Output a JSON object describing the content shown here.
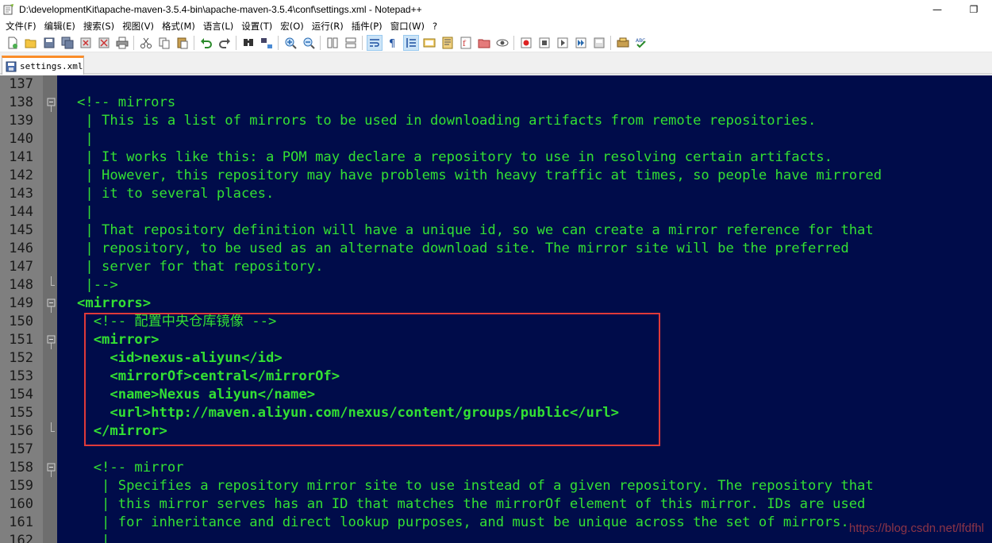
{
  "window": {
    "title": "D:\\developmentKit\\apache-maven-3.5.4-bin\\apache-maven-3.5.4\\conf\\settings.xml - Notepad++",
    "minimize": "—",
    "maximize": "❐"
  },
  "menu": {
    "items": [
      {
        "label": "文件(F)"
      },
      {
        "label": "编辑(E)"
      },
      {
        "label": "搜索(S)"
      },
      {
        "label": "视图(V)"
      },
      {
        "label": "格式(M)"
      },
      {
        "label": "语言(L)"
      },
      {
        "label": "设置(T)"
      },
      {
        "label": "宏(O)"
      },
      {
        "label": "运行(R)"
      },
      {
        "label": "插件(P)"
      },
      {
        "label": "窗口(W)"
      },
      {
        "label": "?"
      }
    ]
  },
  "tab": {
    "label": "settings.xml"
  },
  "colors": {
    "editor_bg": "#000c4a",
    "code_green": "#33e033",
    "gutter": "#7f7f7f",
    "highlight": "#e03a3a",
    "tab_accent": "#fa8d29"
  },
  "lines": [
    {
      "num": "137",
      "text": "",
      "fold": "line",
      "style": "comment"
    },
    {
      "num": "138",
      "text": "<!-- mirrors",
      "fold": "open",
      "style": "comment"
    },
    {
      "num": "139",
      "text": " | This is a list of mirrors to be used in downloading artifacts from remote repositories.",
      "fold": "line",
      "style": "comment"
    },
    {
      "num": "140",
      "text": " |",
      "fold": "line",
      "style": "comment"
    },
    {
      "num": "141",
      "text": " | It works like this: a POM may declare a repository to use in resolving certain artifacts.",
      "fold": "line",
      "style": "comment"
    },
    {
      "num": "142",
      "text": " | However, this repository may have problems with heavy traffic at times, so people have mirrored",
      "fold": "line",
      "style": "comment"
    },
    {
      "num": "143",
      "text": " | it to several places.",
      "fold": "line",
      "style": "comment"
    },
    {
      "num": "144",
      "text": " |",
      "fold": "line",
      "style": "comment"
    },
    {
      "num": "145",
      "text": " | That repository definition will have a unique id, so we can create a mirror reference for that",
      "fold": "line",
      "style": "comment"
    },
    {
      "num": "146",
      "text": " | repository, to be used as an alternate download site. The mirror site will be the preferred",
      "fold": "line",
      "style": "comment"
    },
    {
      "num": "147",
      "text": " | server for that repository.",
      "fold": "line",
      "style": "comment"
    },
    {
      "num": "148",
      "text": " |-->",
      "fold": "end",
      "style": "comment"
    },
    {
      "num": "149",
      "text": "<mirrors>",
      "fold": "open",
      "style": "bold"
    },
    {
      "num": "150",
      "text": "  <!-- 配置中央仓库镜像 -->",
      "fold": "line",
      "style": "comment"
    },
    {
      "num": "151",
      "text": "  <mirror>",
      "fold": "open",
      "style": "bold"
    },
    {
      "num": "152",
      "text": "    <id>nexus-aliyun</id>",
      "fold": "line",
      "style": "bold"
    },
    {
      "num": "153",
      "text": "    <mirrorOf>central</mirrorOf>",
      "fold": "line",
      "style": "bold"
    },
    {
      "num": "154",
      "text": "    <name>Nexus aliyun</name>",
      "fold": "line",
      "style": "bold"
    },
    {
      "num": "155",
      "text": "    <url>http://maven.aliyun.com/nexus/content/groups/public</url>",
      "fold": "line",
      "style": "bold"
    },
    {
      "num": "156",
      "text": "  </mirror>",
      "fold": "end",
      "style": "bold"
    },
    {
      "num": "157",
      "text": "",
      "fold": "line",
      "style": "comment"
    },
    {
      "num": "158",
      "text": "  <!-- mirror",
      "fold": "open",
      "style": "comment"
    },
    {
      "num": "159",
      "text": "   | Specifies a repository mirror site to use instead of a given repository. The repository that",
      "fold": "line",
      "style": "comment"
    },
    {
      "num": "160",
      "text": "   | this mirror serves has an ID that matches the mirrorOf element of this mirror. IDs are used",
      "fold": "line",
      "style": "comment"
    },
    {
      "num": "161",
      "text": "   | for inheritance and direct lookup purposes, and must be unique across the set of mirrors.",
      "fold": "line",
      "style": "comment"
    },
    {
      "num": "162",
      "text": "   |",
      "fold": "line",
      "style": "comment"
    }
  ],
  "watermark": "https://blog.csdn.net/lfdfhl"
}
